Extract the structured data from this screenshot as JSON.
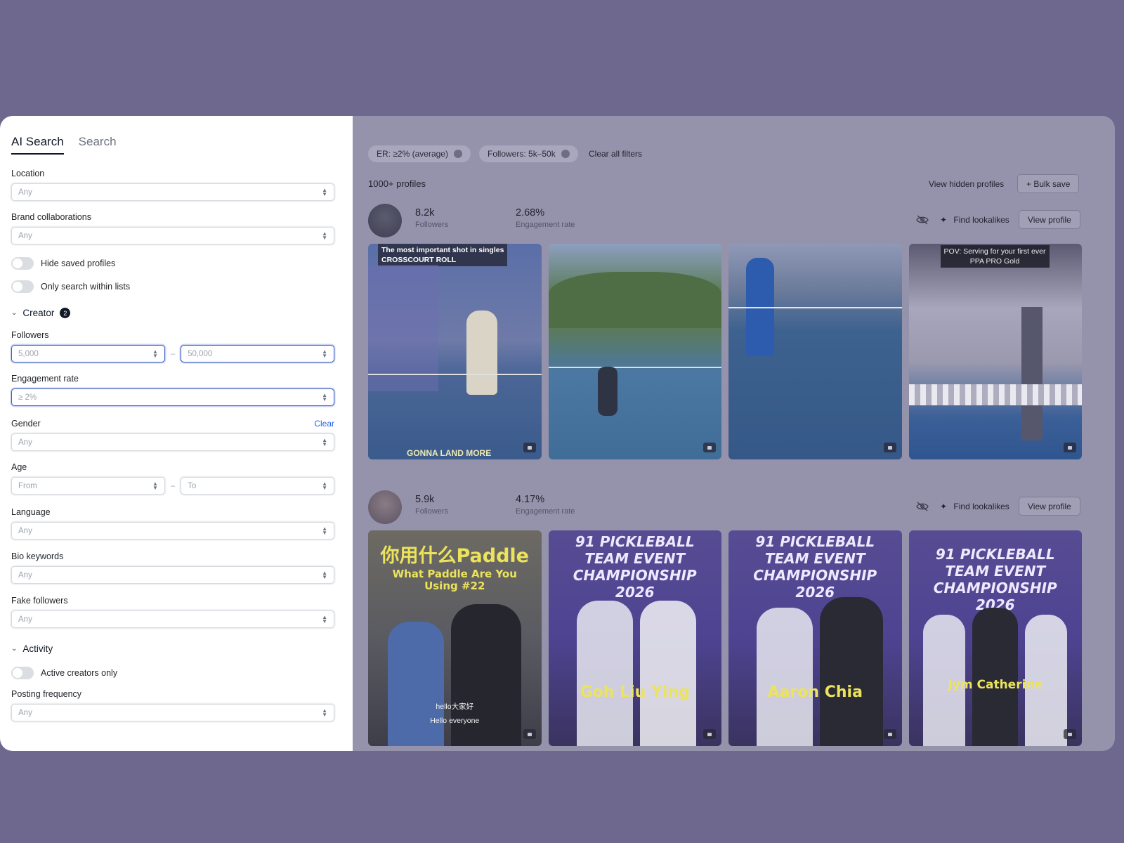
{
  "tabs": [
    {
      "label": "AI Search",
      "active": true
    },
    {
      "label": "Search",
      "active": false
    }
  ],
  "filters": {
    "location": {
      "label": "Location",
      "value": "Any"
    },
    "brand_collabs": {
      "label": "Brand collaborations",
      "value": "Any"
    },
    "hide_saved": {
      "label": "Hide saved profiles"
    },
    "only_lists": {
      "label": "Only search within lists"
    },
    "creator_section": {
      "label": "Creator",
      "count": "2"
    },
    "followers": {
      "label": "Followers",
      "min": "5,000",
      "max": "50,000",
      "sep": "–"
    },
    "engagement": {
      "label": "Engagement rate",
      "value": "≥ 2%"
    },
    "gender": {
      "label": "Gender",
      "value": "Any",
      "clear": "Clear"
    },
    "age": {
      "label": "Age",
      "from": "From",
      "to": "To",
      "sep": "–"
    },
    "language": {
      "label": "Language",
      "value": "Any"
    },
    "bio_keywords": {
      "label": "Bio keywords",
      "value": "Any"
    },
    "fake_followers": {
      "label": "Fake followers",
      "value": "Any"
    },
    "activity_section": {
      "label": "Activity"
    },
    "active_only": {
      "label": "Active creators only"
    },
    "posting_freq": {
      "label": "Posting frequency",
      "value": "Any"
    }
  },
  "results": {
    "chips": [
      "ER: ≥2% (average)",
      "Followers: 5k–50k"
    ],
    "clear_all": "Clear all filters",
    "count": "1000+ profiles",
    "view_hidden": "View hidden profiles",
    "bulk_save": "+ Bulk save",
    "profiles": [
      {
        "followers": "8.2k",
        "followers_label": "Followers",
        "er": "2.68%",
        "er_label": "Engagement rate",
        "find_lookalikes": "Find lookalikes",
        "view_profile": "View profile",
        "thumbs": [
          {
            "caption": "The most important shot in singles\nCROSSCOURT ROLL",
            "bottom": "GONNA LAND MORE"
          },
          {
            "caption": ""
          },
          {
            "caption": ""
          },
          {
            "caption": "POV: Serving for your first ever PPA PRO Gold"
          }
        ]
      },
      {
        "followers": "5.9k",
        "followers_label": "Followers",
        "er": "4.17%",
        "er_label": "Engagement rate",
        "find_lookalikes": "Find lookalikes",
        "view_profile": "View profile",
        "thumbs": [
          {
            "title": "你用什么Paddle",
            "subtitle": "What Paddle Are You Using #22",
            "sub": "hello大家好\nHello everyone"
          },
          {
            "title": "91 PICKLEBALL TEAM EVENT CHAMPIONSHIP 2026",
            "name": "Goh Liu Ying"
          },
          {
            "title": "91 PICKLEBALL TEAM EVENT CHAMPIONSHIP 2026",
            "name": "Aaron Chia"
          },
          {
            "title": "91 PICKLEBALL TEAM EVENT CHAMPIONSHIP 2026",
            "name": "Jym Catherine"
          }
        ]
      }
    ]
  }
}
